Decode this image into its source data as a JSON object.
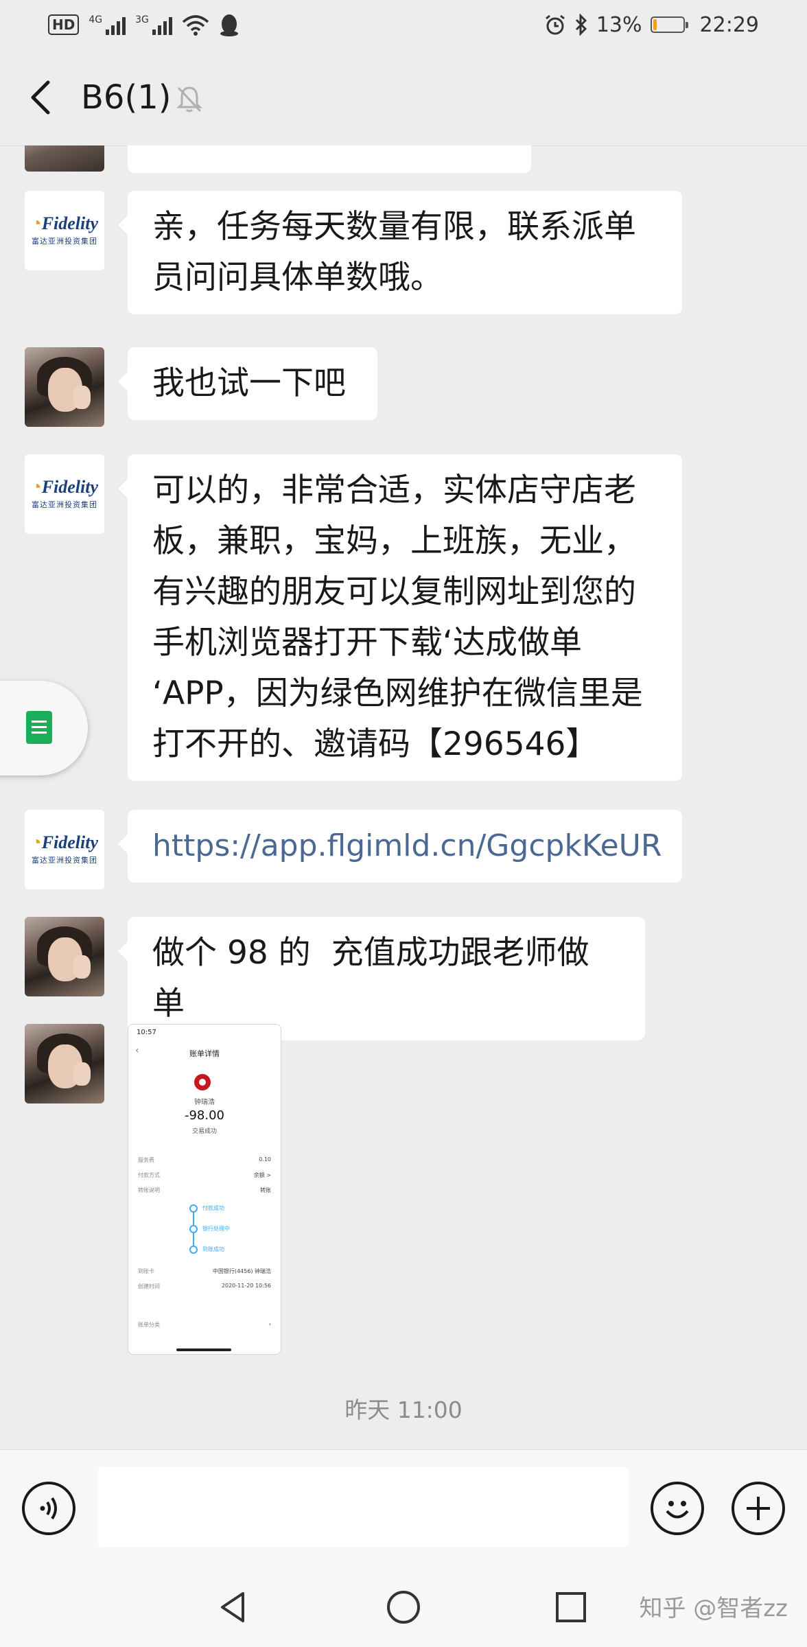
{
  "status_bar": {
    "hd_label": "HD",
    "net1_label": "4G",
    "net2_label": "3G",
    "battery_percent": "13%",
    "battery_level": 0.13,
    "time": "22:29"
  },
  "header": {
    "title": "B6(1)",
    "icons": [
      "back-icon",
      "mute-bell-icon"
    ]
  },
  "messages": [
    {
      "sender": "fidelity",
      "type": "text",
      "text": "亲，任务每天数量有限，联系派单\n员问问具体单数哦。"
    },
    {
      "sender": "user",
      "type": "text",
      "text": "我也试一下吧"
    },
    {
      "sender": "fidelity",
      "type": "text",
      "text": "可以的，非常合适，实体店守店老\n板，兼职，宝妈，上班族，无业，\n有兴趣的朋友可以复制网址到您的\n手机浏览器打开下载‘达成做单\n‘APP，因为绿色网维护在微信里是\n打不开的、邀请码【296546】"
    },
    {
      "sender": "fidelity",
      "type": "link",
      "text": "https://app.flgimld.cn/GgcpkKeUR"
    },
    {
      "sender": "user",
      "type": "text",
      "text": "做个 98 的  充值成功跟老师做单"
    },
    {
      "sender": "user",
      "type": "image",
      "text": ""
    }
  ],
  "avatar_fidelity": {
    "logo": "Fidelity",
    "sub": "富达亚洲投资集团"
  },
  "receipt_thumbnail": {
    "time": "10:57",
    "title": "账单详情",
    "payee": "钟瑞浩",
    "amount": "-98.00",
    "state": "交易成功",
    "rows": [
      {
        "k": "服务费",
        "v": "0.10"
      },
      {
        "k": "付款方式",
        "v": "余额 >"
      },
      {
        "k": "转账说明",
        "v": "转账"
      }
    ],
    "steps": [
      "付款成功",
      "银行处理中",
      "到账成功"
    ],
    "account_label": "到账卡",
    "account_value": "中国银行(4456) 钟瑞浩",
    "created_label": "创建时间",
    "created_value": "2020-11-20 10:56",
    "category_label": "账单分类"
  },
  "timestamp": "昨天 11:00",
  "input_bar": {
    "value": "",
    "icons": [
      "voice-icon",
      "emoji-icon",
      "plus-icon"
    ]
  },
  "nav": {
    "icons": [
      "back-triangle-icon",
      "home-circle-icon",
      "recent-square-icon"
    ]
  },
  "watermark": "知乎 @智者zz"
}
